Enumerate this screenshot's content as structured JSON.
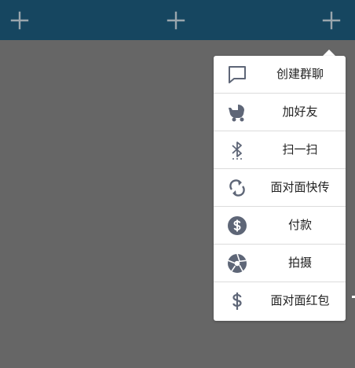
{
  "topbar": {
    "background": "#164660",
    "buttons": [
      {
        "icon": "plus-icon"
      },
      {
        "icon": "plus-icon"
      },
      {
        "icon": "plus-icon"
      }
    ]
  },
  "overlay_color": "#666666",
  "menu": {
    "icon_color": "#5e6677",
    "items": [
      {
        "icon": "chat-bubble-icon",
        "label": "创建群聊"
      },
      {
        "icon": "baby-stroller-icon",
        "label": "加好友"
      },
      {
        "icon": "bluetooth-icon",
        "label": "扫一扫"
      },
      {
        "icon": "sync-arrows-icon",
        "label": "面对面快传"
      },
      {
        "icon": "dollar-circle-icon",
        "label": "付款"
      },
      {
        "icon": "camera-aperture-icon",
        "label": "拍摄"
      },
      {
        "icon": "dollar-sign-icon",
        "label": "面对面红包"
      }
    ]
  }
}
